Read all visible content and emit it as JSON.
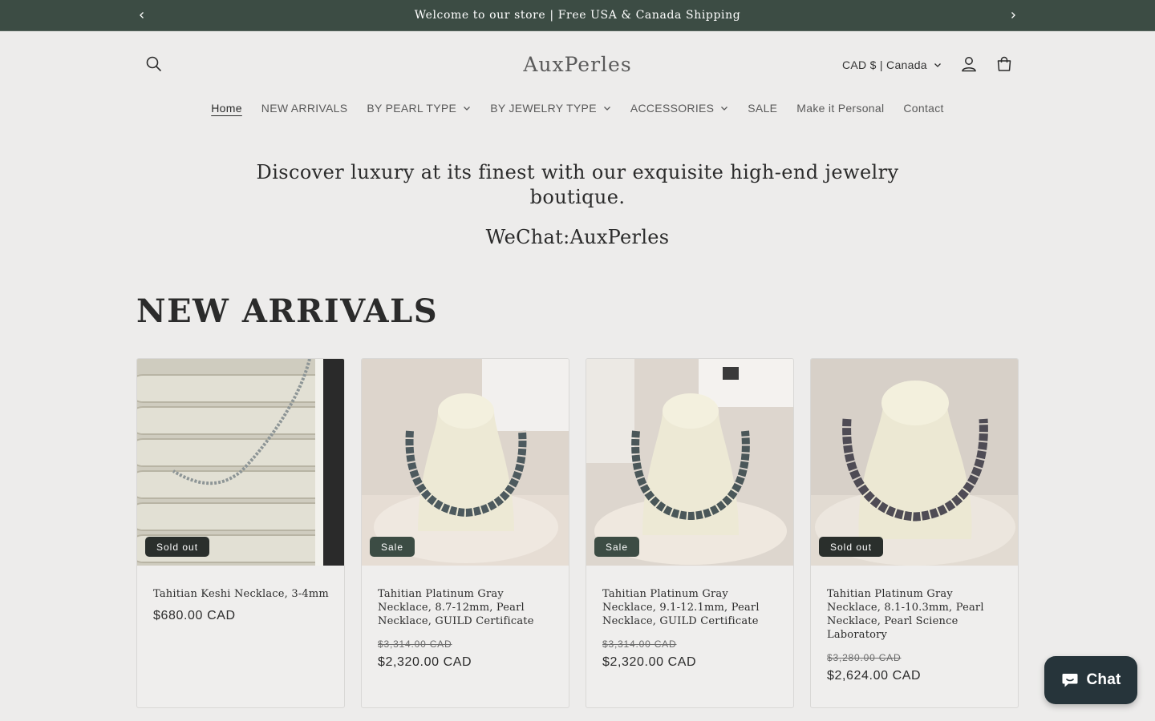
{
  "announcement": {
    "text": "Welcome to our store | Free USA & Canada Shipping",
    "prev_icon": "chevron-left-icon",
    "next_icon": "chevron-right-icon"
  },
  "header": {
    "logo": "AuxPerles",
    "currency": "CAD $ | Canada",
    "icons": [
      "search-icon",
      "account-icon",
      "cart-icon"
    ]
  },
  "nav": {
    "items": [
      {
        "label": "Home",
        "active": true,
        "dropdown": false
      },
      {
        "label": "NEW ARRIVALS",
        "dropdown": false
      },
      {
        "label": "BY PEARL TYPE",
        "dropdown": true
      },
      {
        "label": "BY JEWELRY TYPE",
        "dropdown": true
      },
      {
        "label": "ACCESSORIES",
        "dropdown": true
      },
      {
        "label": "SALE",
        "dropdown": false
      },
      {
        "label": "Make it Personal",
        "dropdown": false
      },
      {
        "label": "Contact",
        "dropdown": false
      }
    ]
  },
  "hero": {
    "line1": "Discover luxury at its finest with our exquisite high-end jewelry",
    "line2": "boutique.",
    "wechat": "WeChat:AuxPerles"
  },
  "section": {
    "title": "NEW ARRIVALS"
  },
  "products": [
    {
      "badge": "Sold out",
      "title": "Tahitian Keshi Necklace, 3-4mm",
      "price_old": "",
      "price": "$680.00 CAD"
    },
    {
      "badge": "Sale",
      "title": "Tahitian Platinum Gray Necklace, 8.7-12mm, Pearl Necklace, GUILD Certificate",
      "price_old": "$3,314.00 CAD",
      "price": "$2,320.00 CAD"
    },
    {
      "badge": "Sale",
      "title": "Tahitian Platinum Gray Necklace, 9.1-12.1mm, Pearl Necklace, GUILD Certificate",
      "price_old": "$3,314.00 CAD",
      "price": "$2,320.00 CAD"
    },
    {
      "badge": "Sold out",
      "title": "Tahitian Platinum Gray Necklace, 8.1-10.3mm, Pearl Necklace, Pearl Science Laboratory",
      "price_old": "$3,280.00 CAD",
      "price": "$2,624.00 CAD"
    }
  ],
  "chat": {
    "label": "Chat",
    "icon": "chat-bubble-icon"
  },
  "colors": {
    "announcement_bg": "#3c4c44",
    "page_bg": "#edeceb",
    "sold_badge": "#2a2f2c",
    "sale_badge": "#3c4c44",
    "chat_bg": "#26343a"
  }
}
